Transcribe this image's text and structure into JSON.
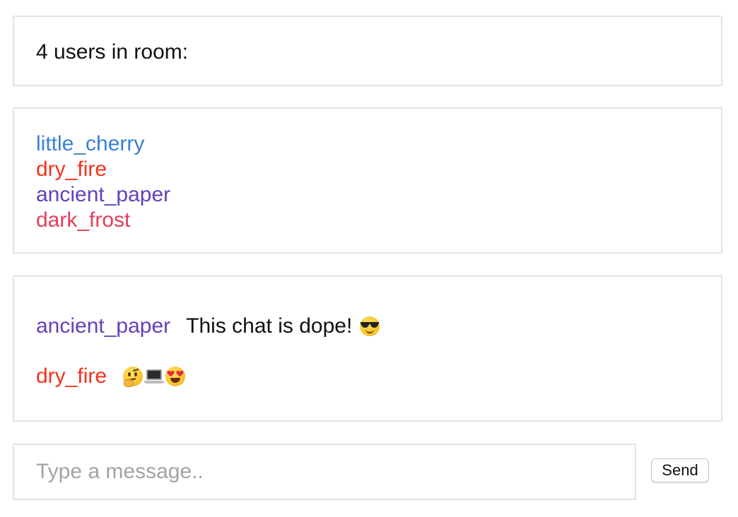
{
  "room": {
    "count_text": "4 users in room:"
  },
  "users": [
    {
      "name": "little_cherry",
      "color": "#3a7fd0"
    },
    {
      "name": "dry_fire",
      "color": "#f2321c"
    },
    {
      "name": "ancient_paper",
      "color": "#6241b7"
    },
    {
      "name": "dark_frost",
      "color": "#e43e5a"
    }
  ],
  "messages": [
    {
      "user": "ancient_paper",
      "user_color": "#6241b7",
      "text": "This chat is dope!",
      "emojis": [
        "sunglasses-face"
      ]
    },
    {
      "user": "dry_fire",
      "user_color": "#f2321c",
      "text": "",
      "emojis": [
        "thinking-face",
        "laptop",
        "heart-eyes-face"
      ]
    }
  ],
  "composer": {
    "placeholder": "Type a message..",
    "value": "",
    "send_label": "Send"
  }
}
